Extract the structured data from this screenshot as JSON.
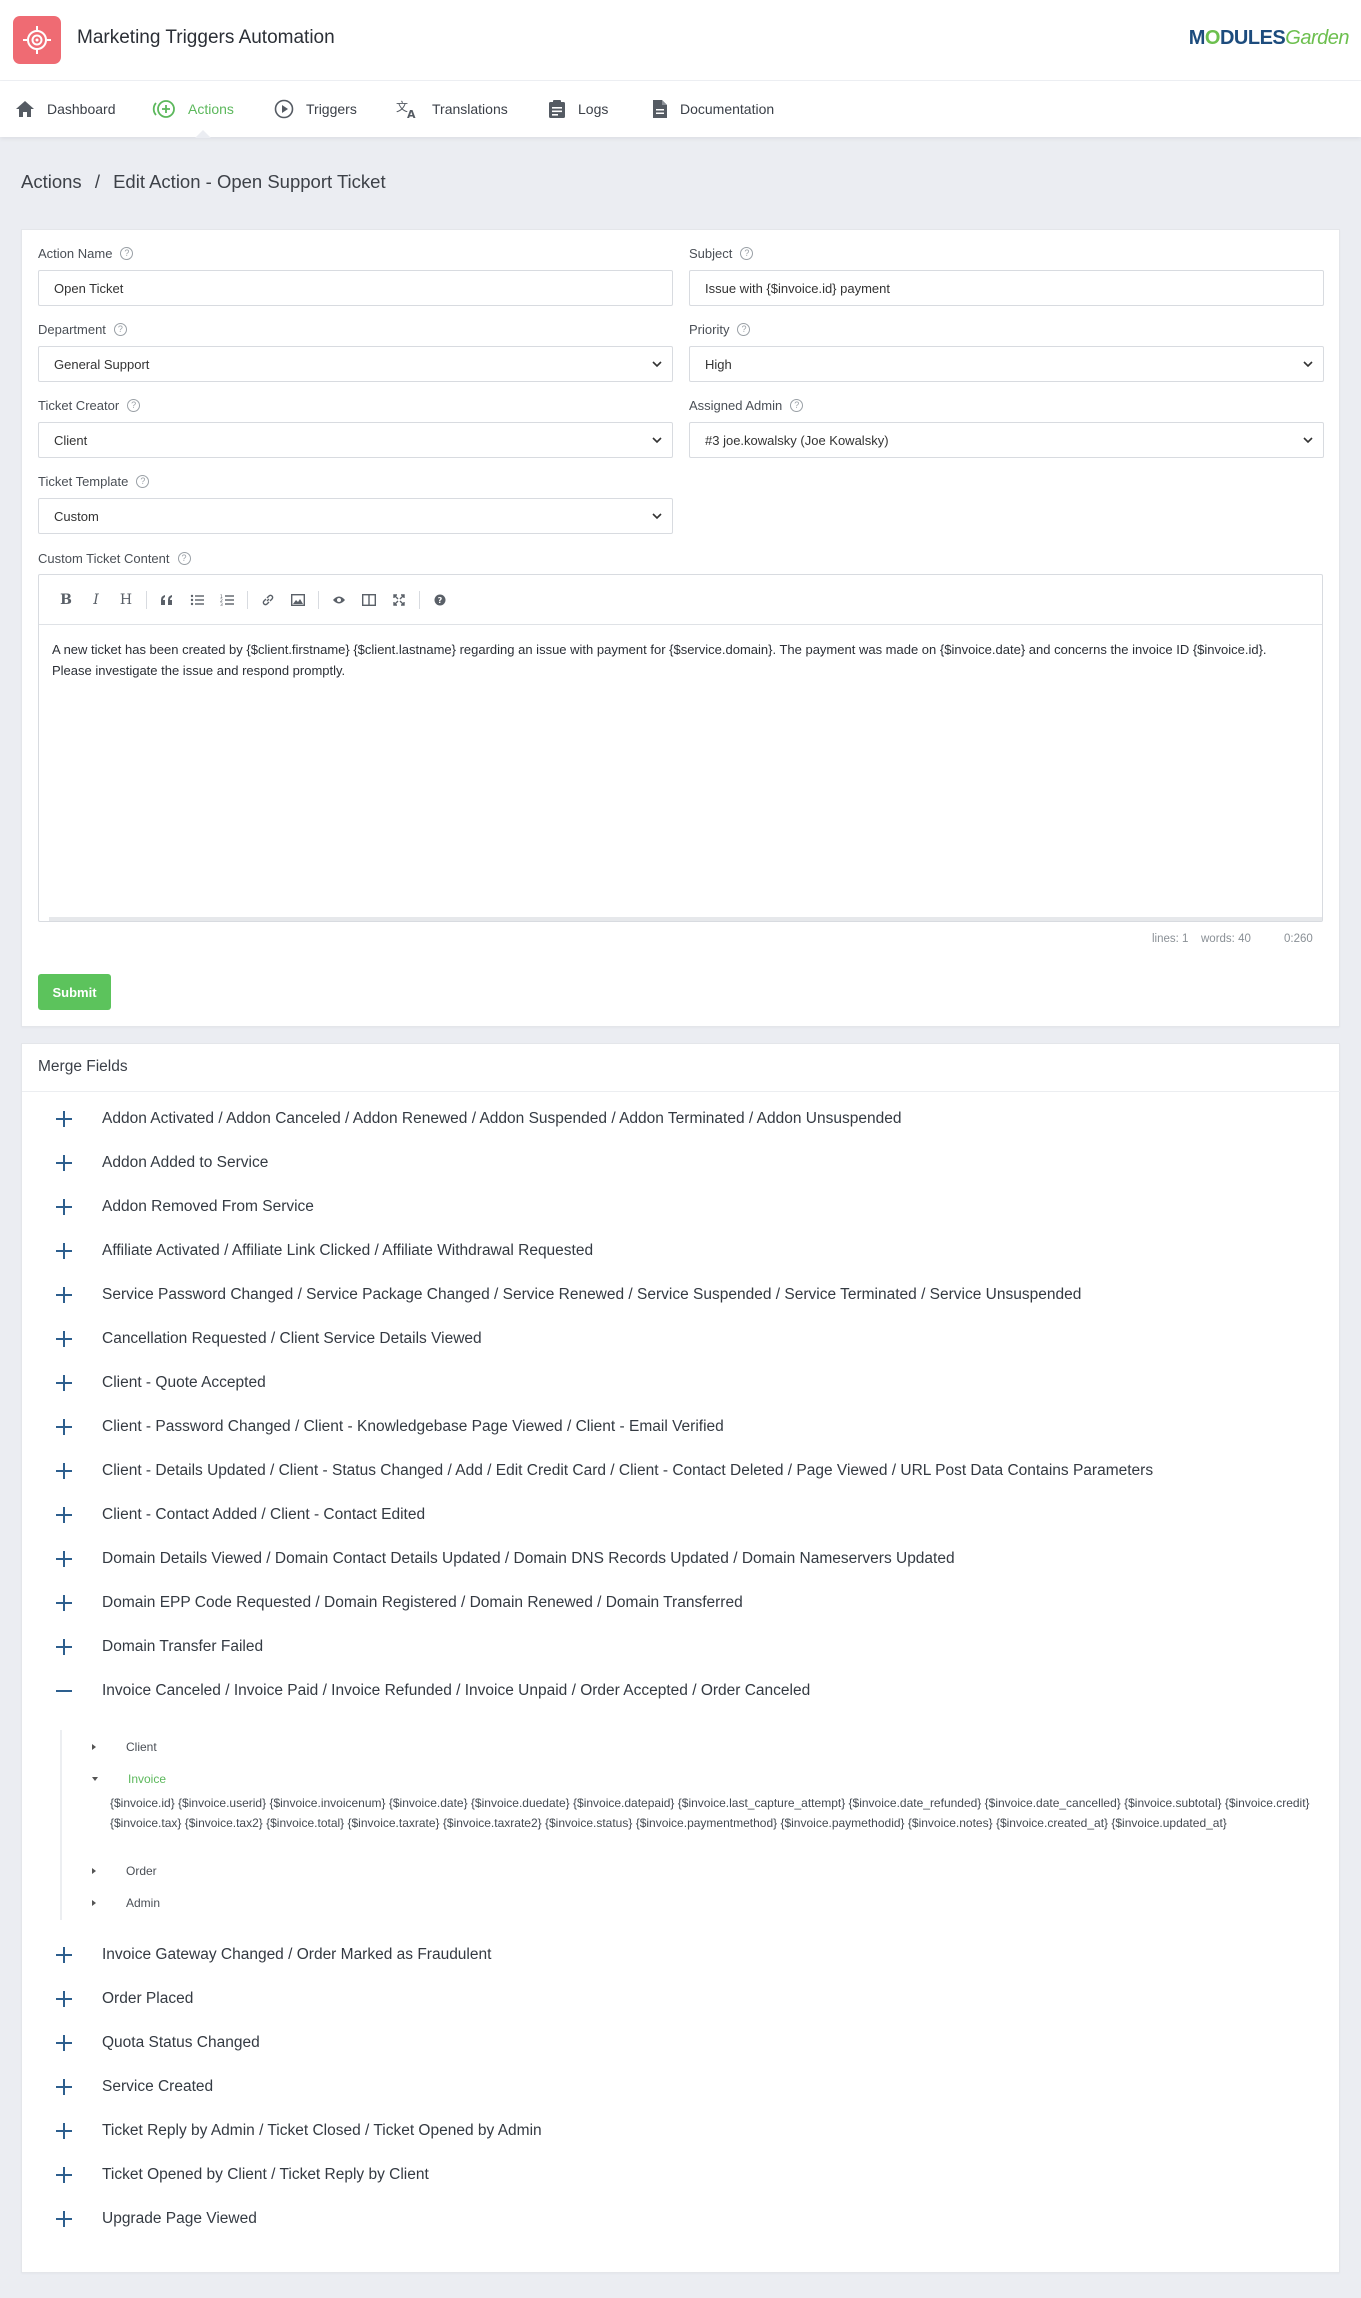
{
  "app": {
    "title": "Marketing Triggers Automation",
    "brand_prefix": "M",
    "brand_o": "O",
    "brand_mid": "DULES",
    "brand_suffix": "Garden"
  },
  "nav": [
    {
      "label": "Dashboard",
      "icon": "home-icon"
    },
    {
      "label": "Actions",
      "icon": "add-circle-icon",
      "active": true
    },
    {
      "label": "Triggers",
      "icon": "play-circle-icon"
    },
    {
      "label": "Translations",
      "icon": "translate-icon"
    },
    {
      "label": "Logs",
      "icon": "clipboard-icon"
    },
    {
      "label": "Documentation",
      "icon": "document-icon"
    }
  ],
  "breadcrumb": {
    "root": "Actions",
    "separator": "/",
    "current": "Edit Action - Open Support Ticket"
  },
  "form": {
    "action_name": {
      "label": "Action Name",
      "value": "Open Ticket"
    },
    "subject": {
      "label": "Subject",
      "value": "Issue with {$invoice.id} payment"
    },
    "department": {
      "label": "Department",
      "value": "General Support"
    },
    "priority": {
      "label": "Priority",
      "value": "High"
    },
    "ticket_creator": {
      "label": "Ticket Creator",
      "value": "Client"
    },
    "assigned_admin": {
      "label": "Assigned Admin",
      "value": "#3 joe.kowalsky (Joe Kowalsky)"
    },
    "ticket_template": {
      "label": "Ticket Template",
      "value": "Custom"
    },
    "content": {
      "label": "Custom Ticket Content",
      "text": "A new ticket has been created by {$client.firstname} {$client.lastname} regarding an issue with payment for {$service.domain}. The payment was made on {$invoice.date} and concerns the invoice ID {$invoice.id}. Please investigate the issue and respond promptly."
    },
    "status": {
      "lines": "lines: 1",
      "words": "words: 40",
      "cursor": "0:260"
    },
    "submit_label": "Submit"
  },
  "merge_fields": {
    "title": "Merge Fields",
    "groups": [
      "Addon Activated / Addon Canceled / Addon Renewed / Addon Suspended / Addon Terminated / Addon Unsuspended",
      "Addon Added to Service",
      "Addon Removed From Service",
      "Affiliate Activated / Affiliate Link Clicked / Affiliate Withdrawal Requested",
      "Service Password Changed / Service Package Changed / Service Renewed / Service Suspended / Service Terminated / Service Unsuspended",
      "Cancellation Requested / Client Service Details Viewed",
      "Client - Quote Accepted",
      "Client - Password Changed / Client - Knowledgebase Page Viewed / Client - Email Verified",
      "Client - Details Updated / Client - Status Changed / Add / Edit Credit Card / Client - Contact Deleted / Page Viewed / URL Post Data Contains Parameters",
      "Client - Contact Added / Client - Contact Edited",
      "Domain Details Viewed / Domain Contact Details Updated / Domain DNS Records Updated / Domain Nameservers Updated",
      "Domain EPP Code Requested / Domain Registered / Domain Renewed / Domain Transferred",
      "Domain Transfer Failed",
      "Invoice Canceled / Invoice Paid / Invoice Refunded / Invoice Unpaid / Order Accepted / Order Canceled",
      "Invoice Gateway Changed / Order Marked as Fraudulent",
      "Order Placed",
      "Quota Status Changed",
      "Service Created",
      "Ticket Reply by Admin / Ticket Closed / Ticket Opened by Admin",
      "Ticket Opened by Client / Ticket Reply by Client",
      "Upgrade Page Viewed"
    ],
    "expanded_children": [
      "Client",
      "Invoice",
      "Order",
      "Admin"
    ],
    "invoice_vars": "{$invoice.id} {$invoice.userid} {$invoice.invoicenum} {$invoice.date} {$invoice.duedate} {$invoice.datepaid} {$invoice.last_capture_attempt} {$invoice.date_refunded} {$invoice.date_cancelled} {$invoice.subtotal} {$invoice.credit} {$invoice.tax} {$invoice.tax2} {$invoice.total} {$invoice.taxrate} {$invoice.taxrate2} {$invoice.status} {$invoice.paymentmethod} {$invoice.paymethodid} {$invoice.notes} {$invoice.created_at} {$invoice.updated_at}"
  },
  "colors": {
    "accent": "#5cb85c",
    "logo_bg": "#ef6b73",
    "brand_blue": "#1d4c7d",
    "tree_sign": "#2d5f8e"
  }
}
